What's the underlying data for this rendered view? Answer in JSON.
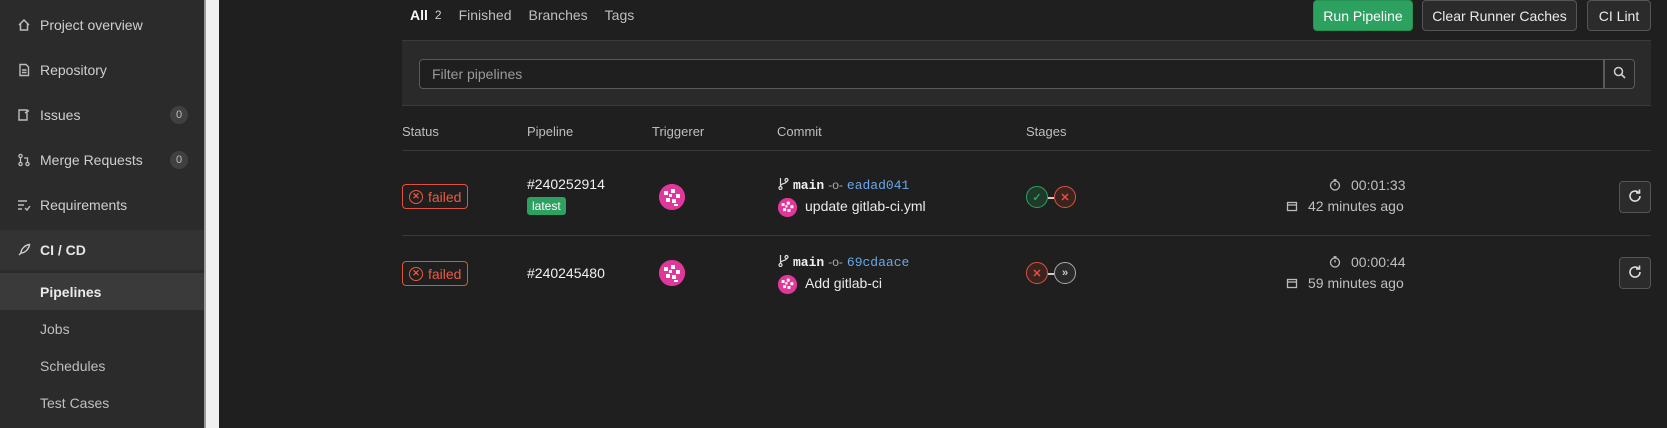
{
  "sidebar": {
    "items": [
      {
        "label": "Project overview",
        "icon": "home-icon"
      },
      {
        "label": "Repository",
        "icon": "doc-icon"
      },
      {
        "label": "Issues",
        "icon": "issues-icon",
        "count": "0"
      },
      {
        "label": "Merge Requests",
        "icon": "merge-request-icon",
        "count": "0"
      },
      {
        "label": "Requirements",
        "icon": "requirements-icon"
      },
      {
        "label": "CI / CD",
        "icon": "rocket-icon"
      }
    ],
    "sub_items": [
      "Pipelines",
      "Jobs",
      "Schedules",
      "Test Cases"
    ]
  },
  "tabs": [
    {
      "label": "All",
      "count": "2"
    },
    {
      "label": "Finished"
    },
    {
      "label": "Branches"
    },
    {
      "label": "Tags"
    }
  ],
  "actions": {
    "run_pipeline": "Run Pipeline",
    "clear_caches": "Clear Runner Caches",
    "ci_lint": "CI Lint"
  },
  "filter": {
    "placeholder": "Filter pipelines"
  },
  "table": {
    "headers": [
      "Status",
      "Pipeline",
      "Triggerer",
      "Commit",
      "Stages"
    ],
    "rows": [
      {
        "status": "failed",
        "pipeline_id": "#240252914",
        "badge": "latest",
        "branch": "main",
        "sha": "eadad041",
        "message": "update gitlab-ci.yml",
        "stages": [
          "passed",
          "failed"
        ],
        "duration": "00:01:33",
        "finished": "42 minutes ago"
      },
      {
        "status": "failed",
        "pipeline_id": "#240245480",
        "branch": "main",
        "sha": "69cdaace",
        "message": "Add gitlab-ci",
        "stages": [
          "failed",
          "skipped"
        ],
        "duration": "00:00:44",
        "finished": "59 minutes ago"
      }
    ]
  },
  "colors": {
    "accent_green": "#2da160",
    "failed_red": "#ec5941",
    "link_blue": "#6ba7e8",
    "avatar_pink": "#e0379a"
  }
}
